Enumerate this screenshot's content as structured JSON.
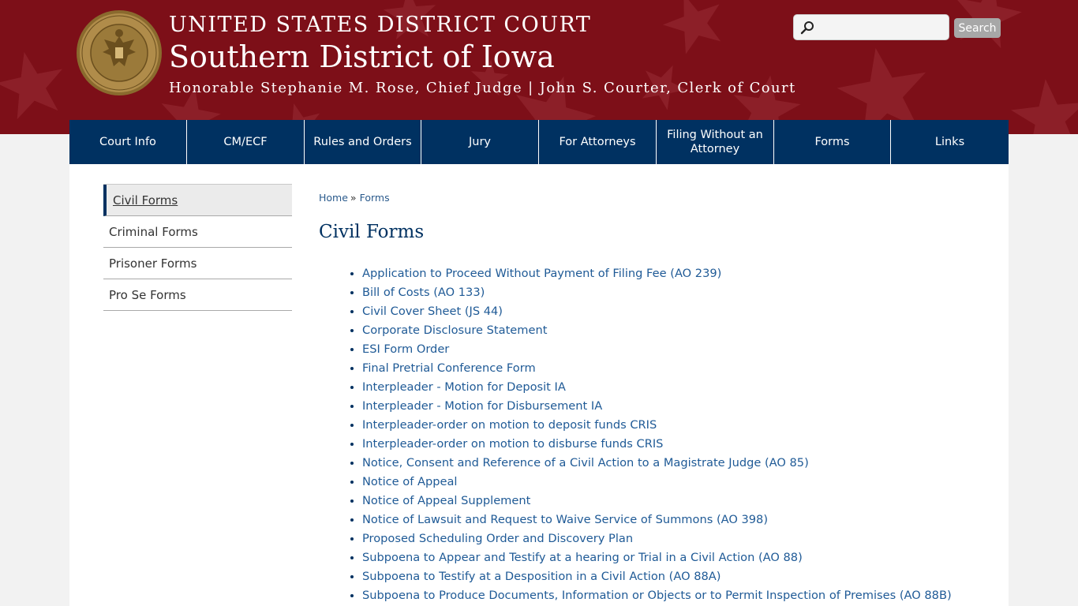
{
  "header": {
    "court_name": "UNITED STATES DISTRICT COURT",
    "district_name": "Southern District of Iowa",
    "officials": "Honorable Stephanie M. Rose, Chief Judge | John S. Courter, Clerk of Court",
    "seal_icon": "court-seal-icon",
    "seal_text": "UNITED STATES DISTRICT COURT · SOUTHERN DISTRICT OF IOWA"
  },
  "search": {
    "placeholder": "",
    "value": "",
    "button_label": "Search",
    "icon": "search-icon"
  },
  "nav": {
    "items": [
      {
        "label": "Court Info"
      },
      {
        "label": "CM/ECF"
      },
      {
        "label": "Rules and Orders"
      },
      {
        "label": "Jury"
      },
      {
        "label": "For Attorneys"
      },
      {
        "label": "Filing Without an Attorney"
      },
      {
        "label": "Forms"
      },
      {
        "label": "Links"
      }
    ]
  },
  "sidebar": {
    "items": [
      {
        "label": "Civil Forms",
        "active": true
      },
      {
        "label": "Criminal Forms"
      },
      {
        "label": "Prisoner Forms"
      },
      {
        "label": "Pro Se Forms"
      }
    ]
  },
  "breadcrumb": {
    "home": "Home",
    "separator": "»",
    "current": "Forms"
  },
  "page": {
    "title": "Civil Forms"
  },
  "forms": [
    "Application to Proceed Without Payment of Filing Fee (AO 239)",
    "Bill of Costs (AO 133)",
    "Civil Cover Sheet (JS 44)",
    "Corporate Disclosure Statement",
    "ESI Form Order",
    "Final Pretrial Conference Form",
    "Interpleader - Motion for Deposit IA",
    "Interpleader - Motion for Disbursement IA",
    "Interpleader-order on motion to deposit funds CRIS",
    "Interpleader-order on motion to disburse funds CRIS",
    "Notice, Consent and Reference of a Civil Action to a Magistrate Judge (AO 85)",
    "Notice of Appeal",
    "Notice of Appeal Supplement",
    "Notice of Lawsuit and Request to Waive Service of Summons (AO 398)",
    "Proposed Scheduling Order and Discovery Plan",
    "Subpoena to Appear and Testify at a hearing or Trial in a Civil Action (AO 88)",
    "Subpoena to Testify at a Desposition in a Civil Action (AO 88A)",
    "Subpoena to Produce Documents, Information or Objects or to Permit Inspection of Premises (AO 88B)"
  ],
  "colors": {
    "header_red": "#7d0f18",
    "nav_blue": "#003161",
    "link_blue": "#1f5a96"
  }
}
